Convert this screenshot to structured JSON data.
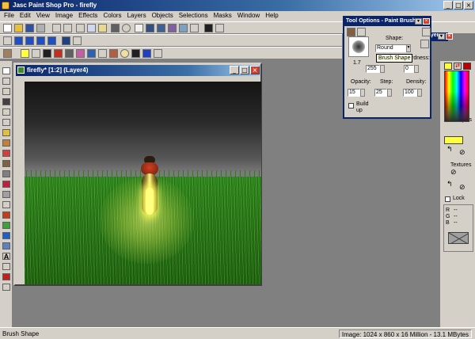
{
  "app": {
    "title": "Jasc Paint Shop Pro - firefly"
  },
  "menu": [
    "File",
    "Edit",
    "View",
    "Image",
    "Effects",
    "Colors",
    "Layers",
    "Objects",
    "Selections",
    "Masks",
    "Window",
    "Help"
  ],
  "document": {
    "title": "firefly* [1:2] (Layer4)"
  },
  "tool_options": {
    "title": "Tool Options - Paint Brush",
    "shape_label": "Shape:",
    "shape_value": "Round",
    "size_value": "1.7",
    "hardness_label": "Hardness:",
    "hardness_short": "rdness:",
    "hardness_value": "0",
    "size_field_value": "255",
    "opacity_label": "Opacity:",
    "opacity_value": "15",
    "step_label": "Step:",
    "step_value": "25",
    "density_label": "Density:",
    "density_value": "100",
    "build_up_label_1": "Build",
    "build_up_label_2": "up",
    "tooltip": "Brush Shape"
  },
  "layer_palette_fragment": "ayer",
  "right_palette": {
    "styles_label": "Styles",
    "textures_label": "Textures",
    "lock_label": "Lock",
    "r_label": "R",
    "g_label": "G",
    "b_label": "B",
    "r_value": "--",
    "g_value": "--",
    "b_value": "--"
  },
  "status": {
    "left": "Brush Shape",
    "right": "Image:  1024 x 860 x 16 Million - 13.1 MBytes"
  },
  "colors": {
    "title_bar": "#0a246a",
    "chrome": "#d4d0c8",
    "workspace": "#808080",
    "foreground_swatch": "#ffff40",
    "grass": "#2a7a18"
  }
}
